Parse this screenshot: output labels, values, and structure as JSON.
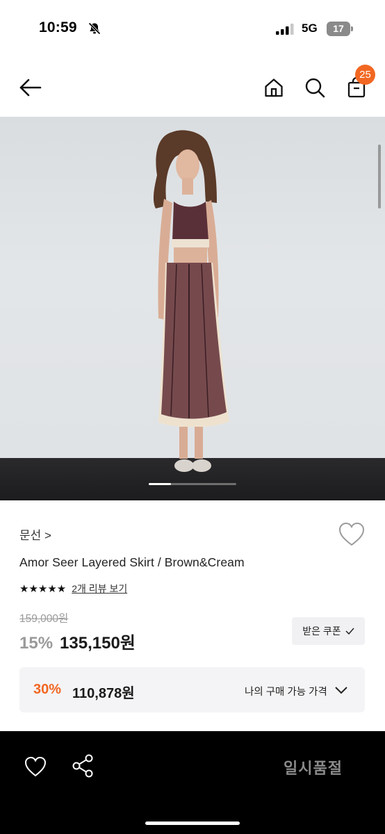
{
  "status_bar": {
    "time": "10:59",
    "network": "5G",
    "battery": "17",
    "icons": [
      "bell-off-icon",
      "signal-icon",
      "battery-icon"
    ]
  },
  "nav": {
    "icons": [
      "back-arrow-icon",
      "home-icon",
      "search-icon",
      "cart-icon"
    ],
    "cart_count": "25"
  },
  "product": {
    "image_alt_icon": "product-photo",
    "brand": "문선 >",
    "title": "Amor Seer Layered Skirt / Brown&Cream",
    "stars": "★★★★★",
    "star_count": 5,
    "review_link": "2개 리뷰 보기",
    "original_price": "159,000원",
    "discount": "15%",
    "price": "135,150원",
    "coupon_button": "받은 쿠폰",
    "my_price": {
      "discount": "30%",
      "price": "110,878원",
      "label": "나의 구매 가능 가격"
    }
  },
  "bottom_bar": {
    "soldout_label": "일시품절",
    "icons": [
      "heart-icon",
      "share-icon"
    ]
  },
  "colors": {
    "accent": "#f26722",
    "muted": "#9a9a9a",
    "bottom_bar": "#000000"
  }
}
